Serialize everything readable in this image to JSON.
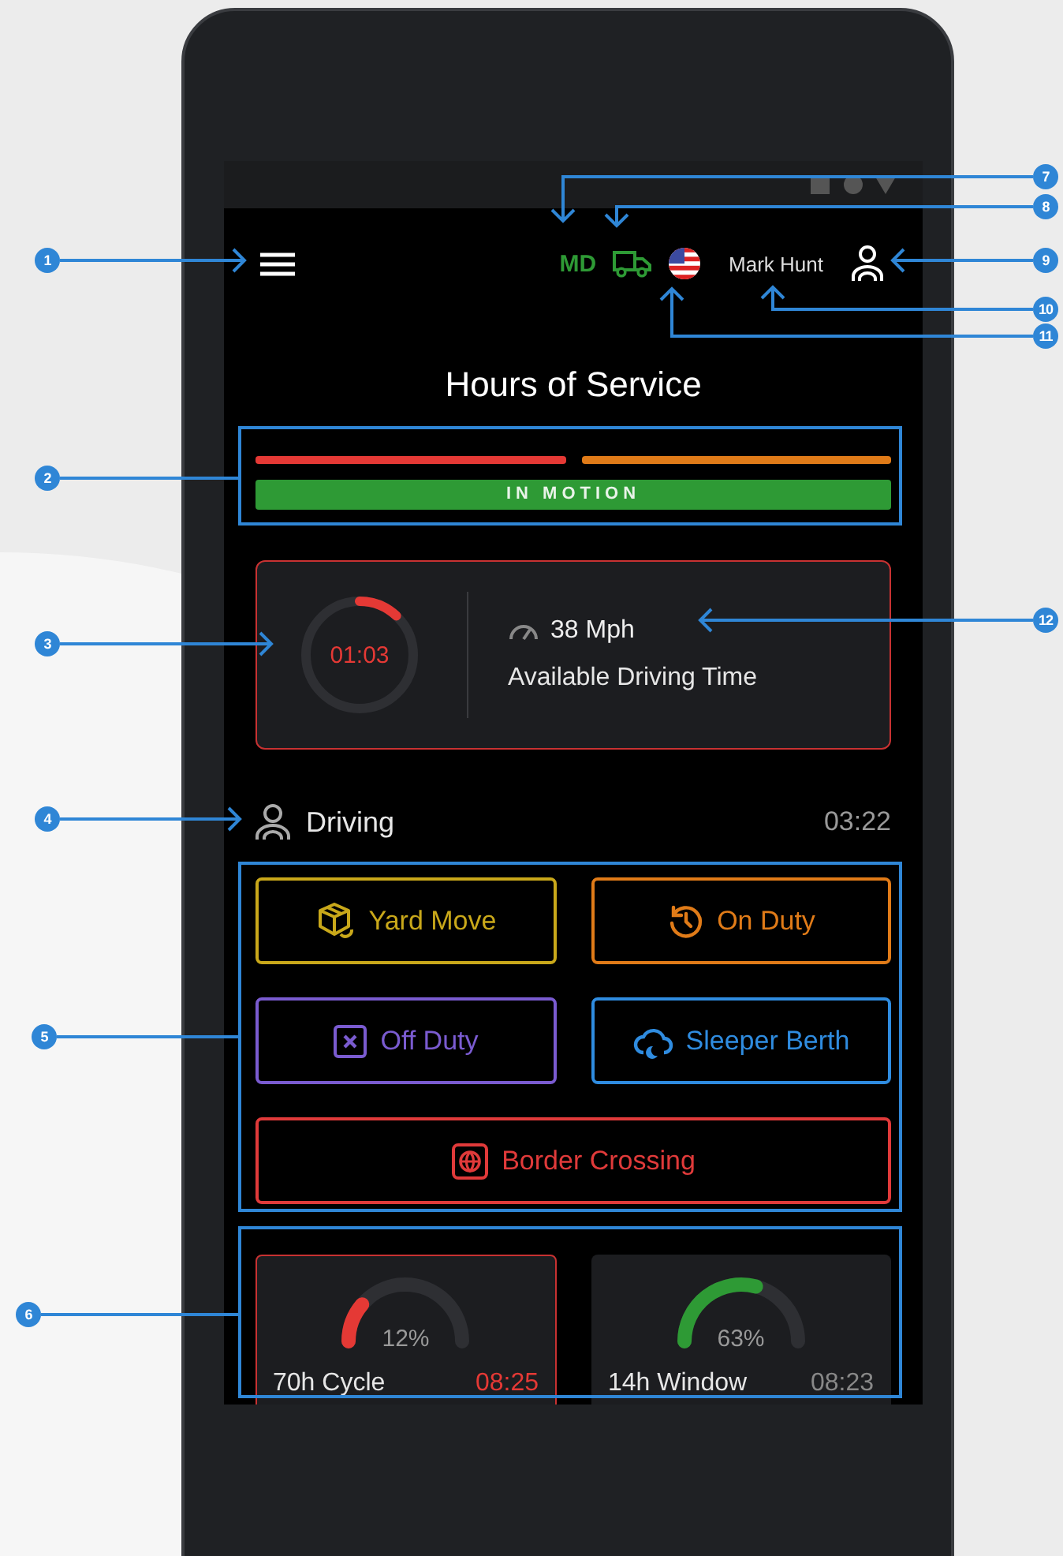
{
  "header": {
    "unit": "MD",
    "user": "Mark Hunt"
  },
  "title": "Hours of Service",
  "motion": {
    "segments": [
      {
        "color": "#e53935"
      },
      {
        "color": "#e07b18"
      }
    ],
    "label": "IN MOTION"
  },
  "driving_card": {
    "time": "01:03",
    "level": 0.12,
    "speed": "38 Mph",
    "label": "Available Driving Time"
  },
  "current_status": {
    "label": "Driving",
    "time": "03:22"
  },
  "duty_buttons": [
    {
      "label": "Yard Move",
      "kind": "yard",
      "color": "#c9a81a"
    },
    {
      "label": "On Duty",
      "kind": "on",
      "color": "#e07b18"
    },
    {
      "label": "Off Duty",
      "kind": "off",
      "color": "#7a5bd0"
    },
    {
      "label": "Sleeper Berth",
      "kind": "sleeper",
      "color": "#2f8ce0"
    },
    {
      "label": "Border Crossing",
      "kind": "border",
      "color": "#e03a3a"
    }
  ],
  "gauges": [
    {
      "percent": "12%",
      "level": 0.12,
      "label": "70h Cycle",
      "time": "08:25",
      "alert": true
    },
    {
      "percent": "63%",
      "level": 0.63,
      "label": "14h Window",
      "time": "08:23",
      "alert": false
    }
  ],
  "callouts": [
    {
      "number": "1"
    },
    {
      "number": "2"
    },
    {
      "number": "3"
    },
    {
      "number": "4"
    },
    {
      "number": "5"
    },
    {
      "number": "6"
    },
    {
      "number": "7"
    },
    {
      "number": "8"
    },
    {
      "number": "9"
    },
    {
      "number": "10"
    },
    {
      "number": "11"
    },
    {
      "number": "12"
    }
  ]
}
